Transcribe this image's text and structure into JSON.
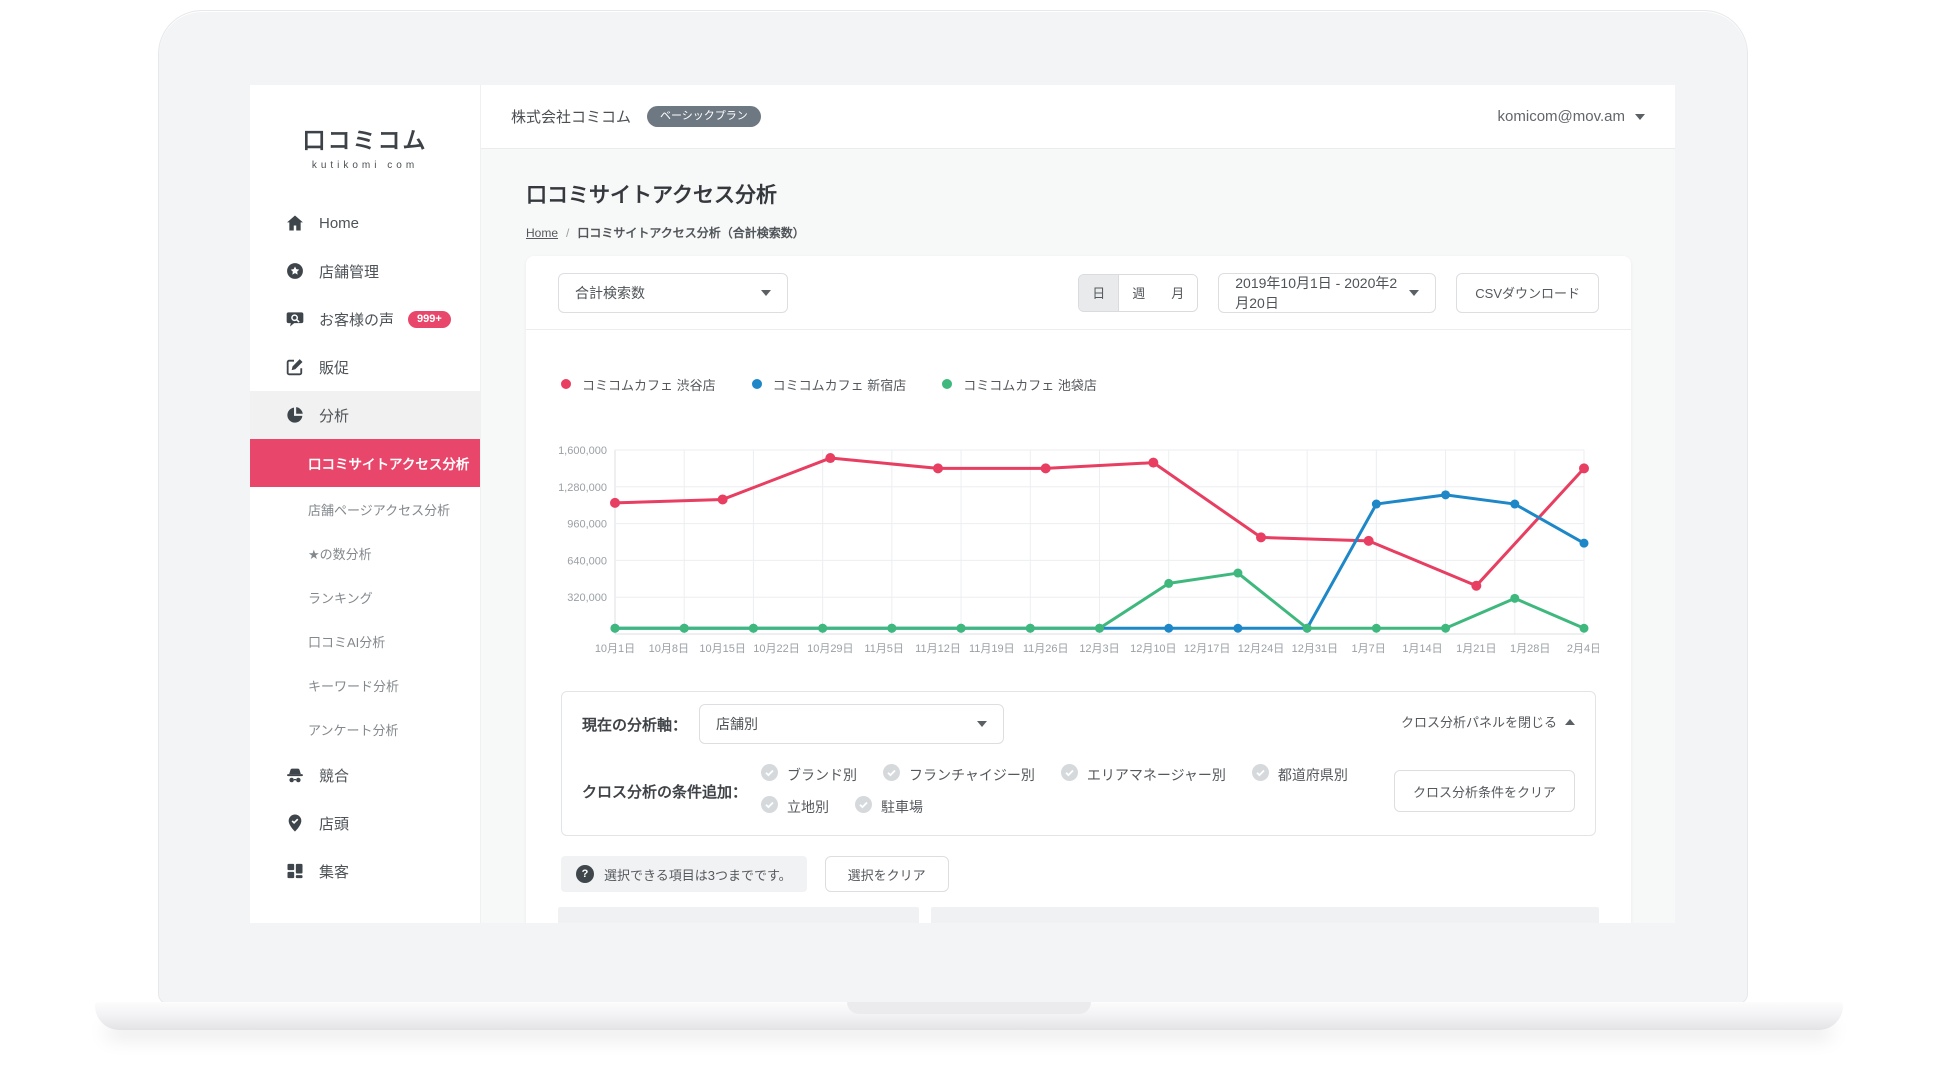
{
  "colors": {
    "accent": "#e8476b",
    "plan_badge_bg": "#6e7882",
    "series_red": "#e73e61",
    "series_blue": "#1d87c8",
    "series_green": "#3fb87e",
    "grid": "#eceef1",
    "axis_line": "#dcdfe2",
    "axis_text": "#9aa0a5"
  },
  "brand": {
    "logo_text": "口コミコム",
    "logo_subtext": "kutikomi com"
  },
  "topbar": {
    "company": "株式会社コミコム",
    "plan_badge": "ベーシックプラン",
    "account_email": "komicom@mov.am"
  },
  "sidebar": {
    "items": [
      {
        "id": "home",
        "label": "Home",
        "icon": "home-icon"
      },
      {
        "id": "store-management",
        "label": "店舗管理",
        "icon": "store-icon"
      },
      {
        "id": "customer-voice",
        "label": "お客様の声",
        "icon": "voice-icon",
        "badge": "999+"
      },
      {
        "id": "promotion",
        "label": "販促",
        "icon": "promo-icon"
      },
      {
        "id": "analysis",
        "label": "分析",
        "icon": "analysis-icon",
        "expanded": true,
        "children": [
          {
            "id": "review-site-access",
            "label": "口コミサイトアクセス分析",
            "active": true
          },
          {
            "id": "store-page-access",
            "label": "店舗ページアクセス分析"
          },
          {
            "id": "star-count",
            "label": "★の数分析"
          },
          {
            "id": "ranking",
            "label": "ランキング"
          },
          {
            "id": "review-ai",
            "label": "口コミAI分析"
          },
          {
            "id": "keyword",
            "label": "キーワード分析"
          },
          {
            "id": "survey",
            "label": "アンケート分析"
          }
        ]
      },
      {
        "id": "competitors",
        "label": "競合",
        "icon": "competitor-icon"
      },
      {
        "id": "storefront",
        "label": "店頭",
        "icon": "storefront-icon"
      },
      {
        "id": "attraction",
        "label": "集客",
        "icon": "attract-icon"
      }
    ]
  },
  "page": {
    "title": "口コミサイトアクセス分析",
    "breadcrumb": {
      "home": "Home",
      "separator": "/",
      "current": "口コミサイトアクセス分析（合計検索数）"
    }
  },
  "controls": {
    "metric_select": "合計検索数",
    "period_options": [
      "日",
      "週",
      "月"
    ],
    "period_selected": "日",
    "date_range": "2019年10月1日 - 2020年2月20日",
    "csv_button": "CSVダウンロード"
  },
  "chart_data": {
    "type": "line",
    "title": "",
    "x_labels": [
      "10月1日",
      "10月8日",
      "10月15日",
      "10月22日",
      "10月29日",
      "11月5日",
      "11月12日",
      "11月19日",
      "11月26日",
      "12月3日",
      "12月10日",
      "12月17日",
      "12月24日",
      "12月31日",
      "1月7日",
      "1月14日",
      "1月21日",
      "1月28日",
      "2月4日"
    ],
    "y_ticks": [
      320000,
      640000,
      960000,
      1280000,
      1600000
    ],
    "y_tick_labels": [
      "320,000",
      "640,000",
      "960,000",
      "1,280,000",
      "1,600,000"
    ],
    "ylim": [
      0,
      1600000
    ],
    "grid": {
      "horizontal": true,
      "vertical": true,
      "vertical_count": 15
    },
    "legend_position": "top-left",
    "series": [
      {
        "name": "コミコムカフェ 渋谷店",
        "color_key": "series_red",
        "x_positions_note": "10 points evenly spaced, landing on every 2nd week label",
        "values": [
          1140000,
          1170000,
          1530000,
          1440000,
          1440000,
          1490000,
          840000,
          810000,
          420000,
          1440000
        ]
      },
      {
        "name": "コミコムカフェ 新宿店",
        "color_key": "series_blue",
        "x_positions_note": "15 points evenly spaced across full axis",
        "values": [
          50000,
          50000,
          50000,
          50000,
          50000,
          50000,
          50000,
          50000,
          50000,
          50000,
          50000,
          1130000,
          1210000,
          1130000,
          790000
        ]
      },
      {
        "name": "コミコムカフェ 池袋店",
        "color_key": "series_green",
        "x_positions_note": "15 points evenly spaced across full axis",
        "values": [
          50000,
          50000,
          50000,
          50000,
          50000,
          50000,
          50000,
          50000,
          440000,
          530000,
          50000,
          50000,
          50000,
          310000,
          50000
        ]
      }
    ]
  },
  "cross_panel": {
    "axis_label": "現在の分析軸：",
    "axis_value": "店舗別",
    "close_link": "クロス分析パネルを閉じる",
    "conditions_label": "クロス分析の条件追加：",
    "conditions_row1": [
      "ブランド別",
      "フランチャイジー別",
      "エリアマネージャー別",
      "都道府県別"
    ],
    "conditions_row2": [
      "立地別",
      "駐車場"
    ],
    "clear_button": "クロス分析条件をクリア"
  },
  "note": {
    "help_icon": "?",
    "text": "選択できる項目は3つまでです。",
    "clear_button": "選択をクリア"
  }
}
